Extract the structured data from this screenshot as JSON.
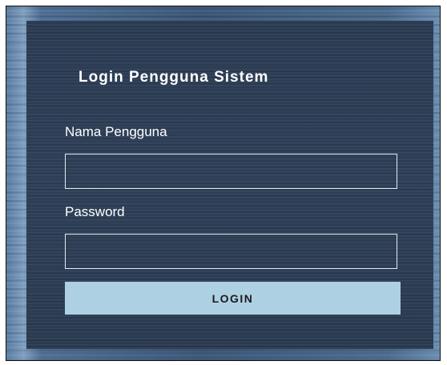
{
  "login_form": {
    "title": "Login Pengguna Sistem",
    "username": {
      "label": "Nama Pengguna",
      "value": "",
      "placeholder": ""
    },
    "password": {
      "label": "Password",
      "value": "",
      "placeholder": ""
    },
    "submit_label": "LOGIN"
  },
  "colors": {
    "panel_background": "#2d3f57",
    "button_background": "#aed0e3",
    "text": "#ffffff"
  }
}
